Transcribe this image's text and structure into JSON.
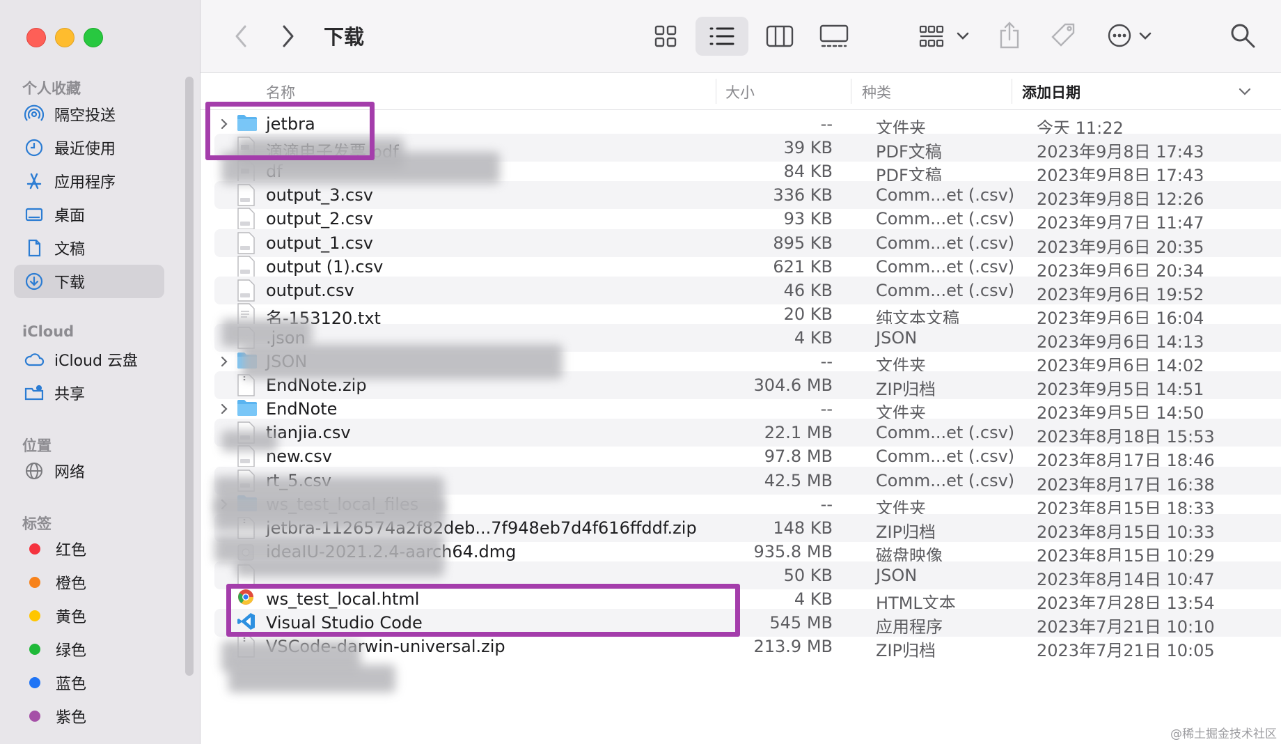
{
  "window": {
    "title": "下载"
  },
  "toolbar": {
    "back_label": "back",
    "forward_label": "forward",
    "views": [
      "icon",
      "list",
      "column",
      "gallery"
    ],
    "active_view": "list"
  },
  "sidebar": {
    "favorites_heading": "个人收藏",
    "favorites": [
      {
        "label": "隔空投送",
        "icon": "airdrop-icon"
      },
      {
        "label": "最近使用",
        "icon": "clock-icon"
      },
      {
        "label": "应用程序",
        "icon": "apps-icon"
      },
      {
        "label": "桌面",
        "icon": "desktop-icon"
      },
      {
        "label": "文稿",
        "icon": "document-icon"
      },
      {
        "label": "下载",
        "icon": "download-icon",
        "selected": true
      }
    ],
    "icloud_heading": "iCloud",
    "icloud": [
      {
        "label": "iCloud 云盘",
        "icon": "cloud-icon"
      },
      {
        "label": "共享",
        "icon": "shared-folder-icon"
      }
    ],
    "locations_heading": "位置",
    "locations": [
      {
        "label": "网络",
        "icon": "globe-icon"
      }
    ],
    "tags_heading": "标签",
    "tags": [
      {
        "label": "红色",
        "color": "#f5333f"
      },
      {
        "label": "橙色",
        "color": "#f7821b"
      },
      {
        "label": "黄色",
        "color": "#ffc600"
      },
      {
        "label": "绿色",
        "color": "#1fb939"
      },
      {
        "label": "蓝色",
        "color": "#1f74f5"
      },
      {
        "label": "紫色",
        "color": "#a550a7"
      }
    ]
  },
  "columns": {
    "name": "名称",
    "size": "大小",
    "kind": "种类",
    "date": "添加日期"
  },
  "files": [
    {
      "name": "jetbra",
      "size": "--",
      "kind": "文件夹",
      "date": "今天 11:22",
      "type": "folder"
    },
    {
      "name": "滴滴电子发票.pdf",
      "size": "39 KB",
      "kind": "PDF文稿",
      "date": "2023年9月8日 17:43",
      "type": "pdf"
    },
    {
      "name": "df",
      "size": "84 KB",
      "kind": "PDF文稿",
      "date": "2023年9月8日 17:43",
      "type": "pdf"
    },
    {
      "name": "output_3.csv",
      "size": "336 KB",
      "kind": "Comm...et (.csv)",
      "date": "2023年9月8日 12:26",
      "type": "csv"
    },
    {
      "name": "output_2.csv",
      "size": "93 KB",
      "kind": "Comm...et (.csv)",
      "date": "2023年9月7日 11:47",
      "type": "csv"
    },
    {
      "name": "output_1.csv",
      "size": "895 KB",
      "kind": "Comm...et (.csv)",
      "date": "2023年9月6日 20:35",
      "type": "csv"
    },
    {
      "name": "output (1).csv",
      "size": "621 KB",
      "kind": "Comm...et (.csv)",
      "date": "2023年9月6日 20:34",
      "type": "csv"
    },
    {
      "name": "output.csv",
      "size": "46 KB",
      "kind": "Comm...et (.csv)",
      "date": "2023年9月6日 19:52",
      "type": "csv"
    },
    {
      "name": "名-153120.txt",
      "size": "20 KB",
      "kind": "纯文本文稿",
      "date": "2023年9月6日 16:04",
      "type": "txt"
    },
    {
      "name": ".json",
      "size": "4 KB",
      "kind": "JSON",
      "date": "2023年9月6日 14:13",
      "type": "file"
    },
    {
      "name": "JSON",
      "size": "--",
      "kind": "文件夹",
      "date": "2023年9月6日 14:02",
      "type": "folder"
    },
    {
      "name": "EndNote.zip",
      "size": "304.6 MB",
      "kind": "ZIP归档",
      "date": "2023年9月5日 14:51",
      "type": "zip"
    },
    {
      "name": "EndNote",
      "size": "--",
      "kind": "文件夹",
      "date": "2023年9月5日 14:50",
      "type": "folder"
    },
    {
      "name": "tianjia.csv",
      "size": "22.1 MB",
      "kind": "Comm...et (.csv)",
      "date": "2023年8月18日 15:53",
      "type": "csv"
    },
    {
      "name": "new.csv",
      "size": "97.8 MB",
      "kind": "Comm...et (.csv)",
      "date": "2023年8月17日 18:46",
      "type": "csv"
    },
    {
      "name": "rt_5.csv",
      "size": "42.5 MB",
      "kind": "Comm...et (.csv)",
      "date": "2023年8月17日 16:38",
      "type": "csv"
    },
    {
      "name": "ws_test_local_files",
      "size": "--",
      "kind": "文件夹",
      "date": "2023年8月15日 18:33",
      "type": "folder"
    },
    {
      "name": "jetbra-1126574a2f82deb...7f948eb7d4f616ffddf.zip",
      "size": "148 KB",
      "kind": "ZIP归档",
      "date": "2023年8月15日 10:33",
      "type": "zip"
    },
    {
      "name": "ideaIU-2021.2.4-aarch64.dmg",
      "size": "935.8 MB",
      "kind": "磁盘映像",
      "date": "2023年8月15日 10:29",
      "type": "dmg"
    },
    {
      "name": "",
      "size": "50 KB",
      "kind": "JSON",
      "date": "2023年8月14日 10:47",
      "type": "file"
    },
    {
      "name": "ws_test_local.html",
      "size": "4 KB",
      "kind": "HTML文本",
      "date": "2023年7月28日 13:54",
      "type": "html"
    },
    {
      "name": "Visual Studio Code",
      "size": "545 MB",
      "kind": "应用程序",
      "date": "2023年7月21日 10:10",
      "type": "app"
    },
    {
      "name": "VSCode-darwin-universal.zip",
      "size": "213.9 MB",
      "kind": "ZIP归档",
      "date": "2023年7月21日 10:05",
      "type": "zip"
    }
  ],
  "watermark": "@稀土掘金技术社区"
}
